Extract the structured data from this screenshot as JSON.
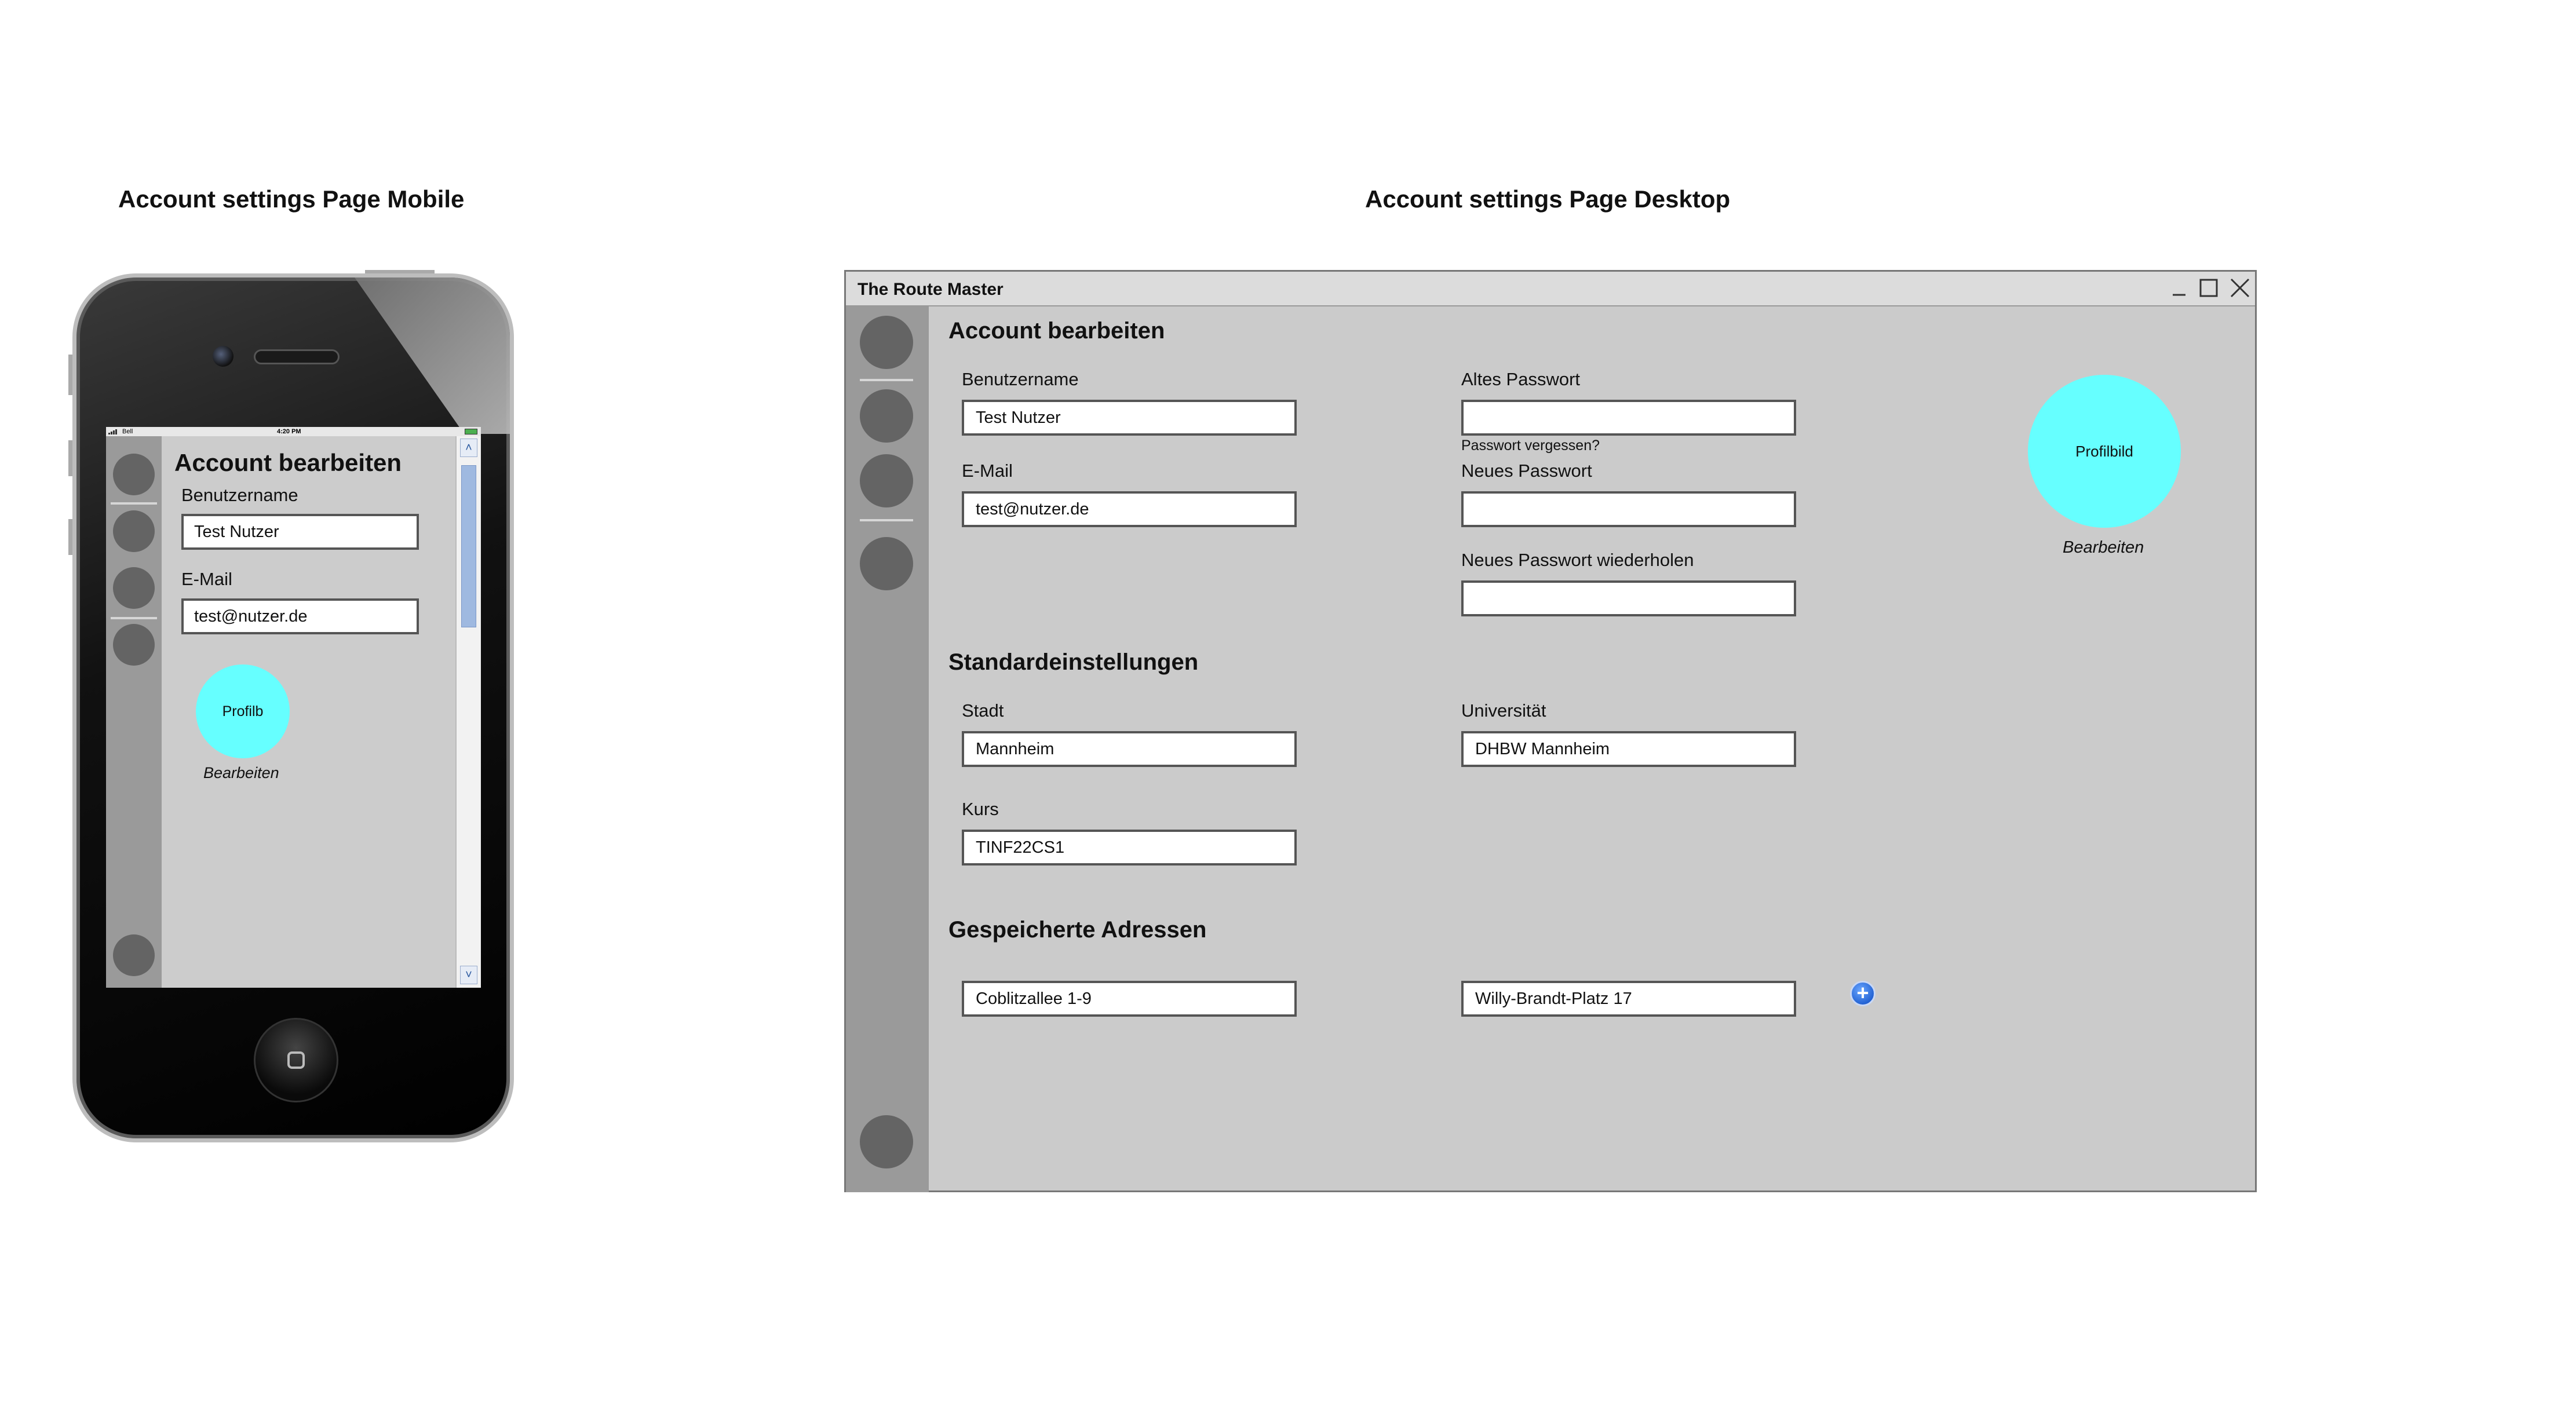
{
  "mobile": {
    "caption": "Account settings Page Mobile",
    "status": {
      "carrier": "Bell",
      "time": "4:20 PM"
    },
    "heading": "Account bearbeiten",
    "fields": [
      {
        "label": "Benutzername",
        "value": "Test Nutzer"
      },
      {
        "label": "E-Mail",
        "value": "test@nutzer.de"
      }
    ],
    "avatar_label": "Profilb",
    "edit_label": "Bearbeiten"
  },
  "desktop": {
    "caption": "Account settings Page Desktop",
    "window_title": "The Route Master",
    "account": {
      "heading": "Account bearbeiten",
      "username_label": "Benutzername",
      "username_value": "Test Nutzer",
      "email_label": "E-Mail",
      "email_value": "test@nutzer.de",
      "old_password_label": "Altes Passwort",
      "old_password_value": "",
      "forgot_password": "Passwort vergessen?",
      "new_password_label": "Neues Passwort",
      "new_password_value": "",
      "repeat_password_label": "Neues Passwort wiederholen",
      "repeat_password_value": ""
    },
    "avatar_label": "Profilbild",
    "edit_label": "Bearbeiten",
    "defaults": {
      "heading": "Standardeinstellungen",
      "city_label": "Stadt",
      "city_value": "Mannheim",
      "university_label": "Universität",
      "university_value": "DHBW Mannheim",
      "course_label": "Kurs",
      "course_value": "TINF22CS1"
    },
    "addresses": {
      "heading": "Gespeicherte Adressen",
      "items": [
        "Coblitzallee 1-9",
        "Willy-Brandt-Platz 17"
      ]
    }
  },
  "colors": {
    "avatar": "#66ffff",
    "sidebar": "#9a9a9a",
    "sidebar_dot": "#646464",
    "content_bg": "#cccccc",
    "add_button": "#1f5fd1"
  },
  "icons": [
    "minimize-icon",
    "maximize-icon",
    "close-icon",
    "add-icon",
    "scroll-up-icon",
    "scroll-down-icon",
    "home-button-icon"
  ]
}
